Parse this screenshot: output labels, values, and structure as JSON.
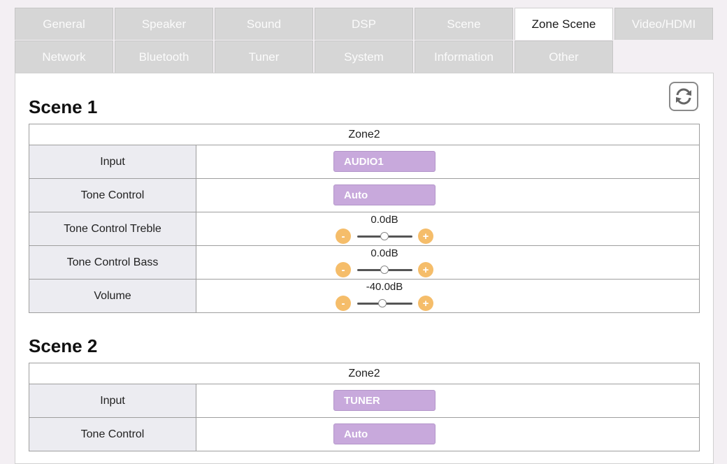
{
  "tabs": {
    "general": "General",
    "speaker": "Speaker",
    "sound": "Sound",
    "dsp": "DSP",
    "scene": "Scene",
    "zone_scene": "Zone Scene",
    "video_hdmi": "Video/HDMI",
    "network": "Network",
    "bluetooth": "Bluetooth",
    "tuner": "Tuner",
    "system": "System",
    "information": "Information",
    "other": "Other"
  },
  "icons": {
    "refresh": "refresh-icon"
  },
  "colors": {
    "select_bg": "#c8a9dc",
    "stepper_btn": "#f5bd6a",
    "active_tab": "#ffffff",
    "inactive_tab": "#d6d6d6"
  },
  "scene1": {
    "title": "Scene 1",
    "zone": "Zone2",
    "input_label": "Input",
    "input_value": "AUDIO1",
    "tone_label": "Tone Control",
    "tone_value": "Auto",
    "treble_label": "Tone Control Treble",
    "treble_value": "0.0dB",
    "bass_label": "Tone Control Bass",
    "bass_value": "0.0dB",
    "volume_label": "Volume",
    "volume_value": "-40.0dB"
  },
  "scene2": {
    "title": "Scene 2",
    "zone": "Zone2",
    "input_label": "Input",
    "input_value": "TUNER",
    "tone_label": "Tone Control",
    "tone_value": "Auto"
  },
  "stepper": {
    "minus": "-",
    "plus": "+"
  }
}
